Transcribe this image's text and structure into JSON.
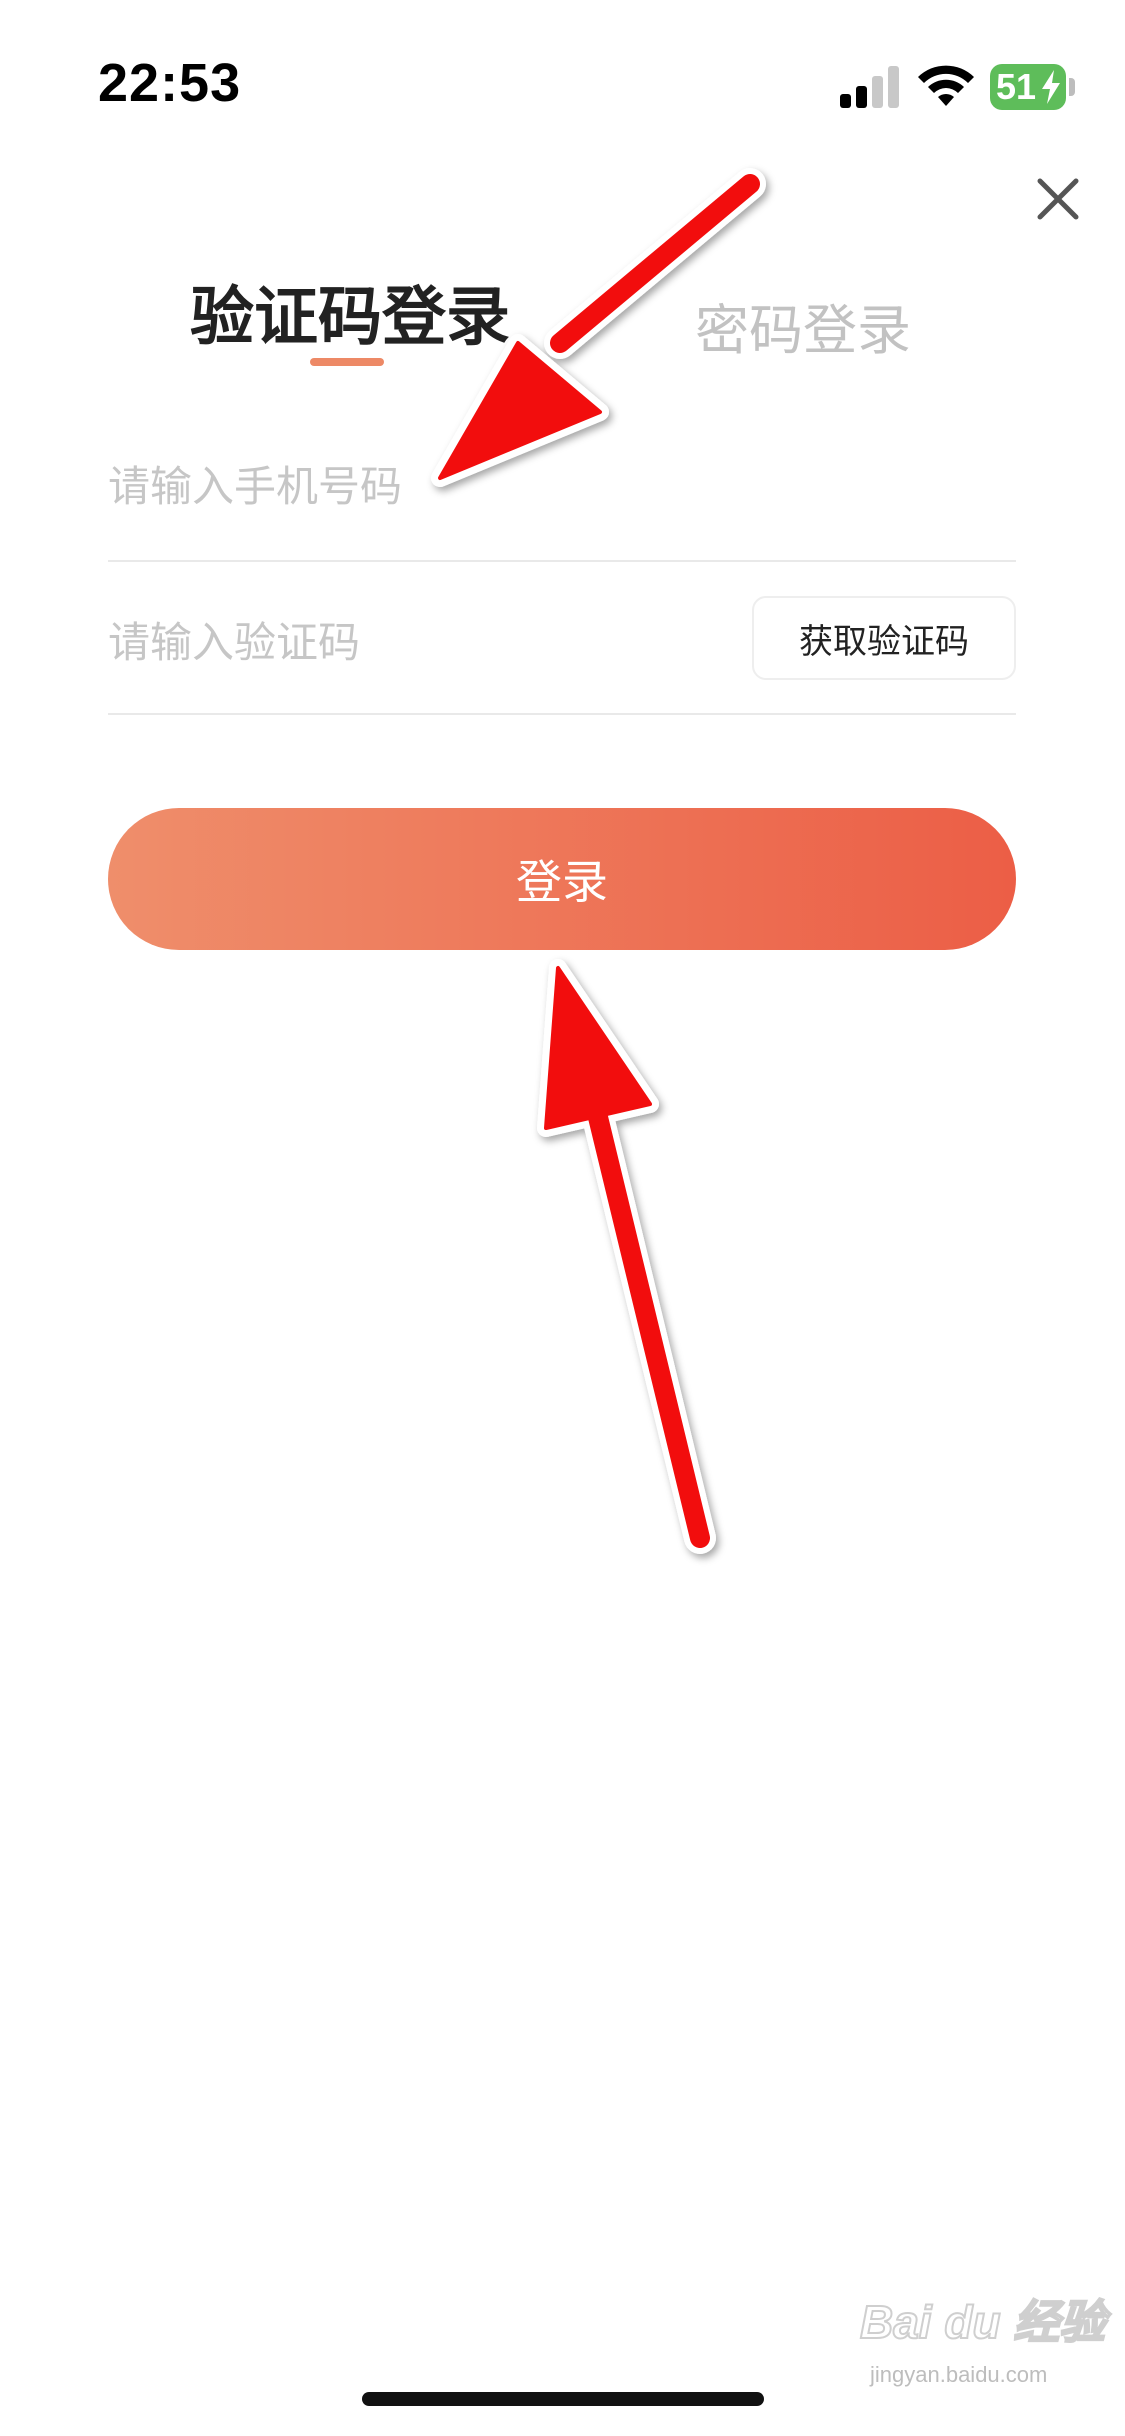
{
  "status_bar": {
    "time": "22:53",
    "battery_level": "51",
    "battery_color": "#5ebd5a",
    "icons": [
      "signal-icon",
      "wifi-icon",
      "battery-icon"
    ]
  },
  "tabs": [
    {
      "label": "验证码登录",
      "active": true
    },
    {
      "label": "密码登录",
      "active": false
    }
  ],
  "form": {
    "phone_placeholder": "请输入手机号码",
    "code_placeholder": "请输入验证码",
    "get_code_label": "获取验证码",
    "login_label": "登录"
  },
  "colors": {
    "accent": "#ed8966",
    "button_gradient_start": "#ef8e6b",
    "button_gradient_end": "#ec5e46",
    "arrow": "#f20c0c"
  },
  "watermark": {
    "logo": "Bai du 经验",
    "url": "jingyan.baidu.com"
  }
}
